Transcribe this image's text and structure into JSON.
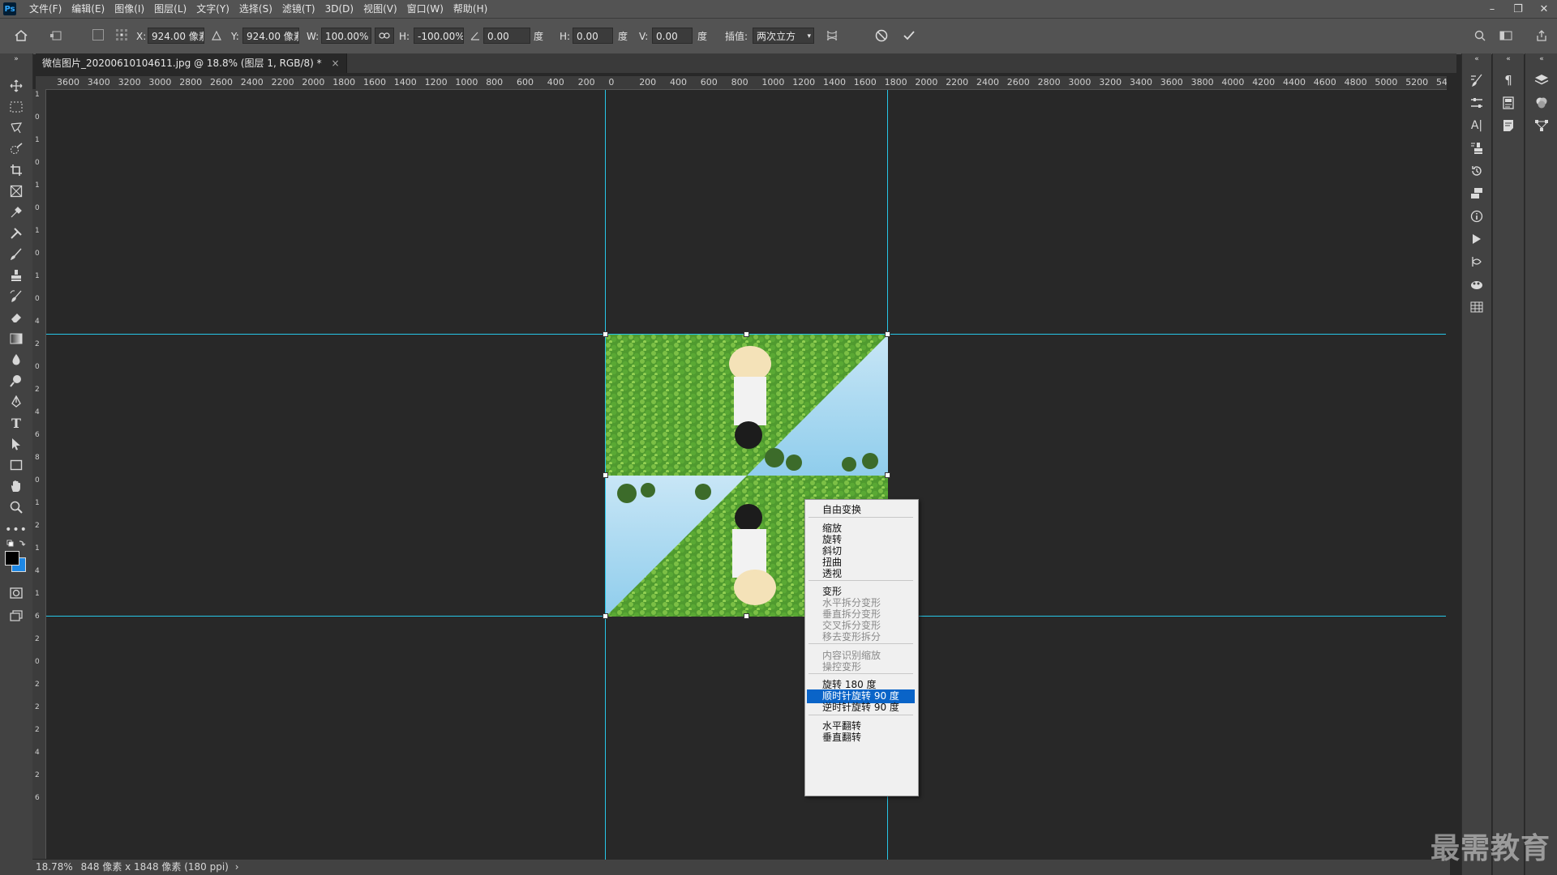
{
  "menubar": {
    "logo": "Ps",
    "items": [
      "文件(F)",
      "编辑(E)",
      "图像(I)",
      "图层(L)",
      "文字(Y)",
      "选择(S)",
      "滤镜(T)",
      "3D(D)",
      "视图(V)",
      "窗口(W)",
      "帮助(H)"
    ]
  },
  "options": {
    "x_label": "X:",
    "x_value": "924.00 像素",
    "y_label": "Y:",
    "y_value": "924.00 像素",
    "w_label": "W:",
    "w_value": "100.00%",
    "h_label": "H:",
    "h_value": "-100.00%",
    "angle_value": "0.00",
    "angle_unit": "度",
    "hskew_label": "H:",
    "hskew_value": "0.00",
    "hskew_unit": "度",
    "vskew_label": "V:",
    "vskew_value": "0.00",
    "vskew_unit": "度",
    "interp_label": "插值:",
    "interp_value": "两次立方"
  },
  "tab": {
    "title": "微信图片_20200610104611.jpg @ 18.8% (图层 1, RGB/8) *",
    "close": "×"
  },
  "ruler": {
    "h_labels": [
      "3600",
      "3400",
      "3200",
      "3000",
      "2800",
      "2600",
      "2400",
      "2200",
      "2000",
      "1800",
      "1600",
      "1400",
      "1200",
      "1000",
      "800",
      "600",
      "400",
      "200",
      "0",
      "200",
      "400",
      "600",
      "800",
      "1000",
      "1200",
      "1400",
      "1600",
      "1800",
      "2000",
      "2200",
      "2400",
      "2600",
      "2800",
      "3000",
      "3200",
      "3400",
      "3600",
      "3800",
      "4000",
      "4200",
      "4400",
      "4600",
      "4800",
      "5000",
      "5200",
      "54"
    ],
    "v_labels": [
      "1",
      "0",
      "1",
      "0",
      "1",
      "0",
      "1",
      "0",
      "1",
      "0",
      "4",
      "2",
      "0",
      "2",
      "4",
      "6",
      "8",
      "0",
      "1",
      "2",
      "1",
      "4",
      "1",
      "6",
      "2",
      "0",
      "2",
      "2",
      "2",
      "4",
      "2",
      "6"
    ]
  },
  "context_menu": {
    "items": [
      {
        "label": "自由变换",
        "disabled": false
      },
      {
        "label": "缩放",
        "disabled": false
      },
      {
        "label": "旋转",
        "disabled": false
      },
      {
        "label": "斜切",
        "disabled": false
      },
      {
        "label": "扭曲",
        "disabled": false
      },
      {
        "label": "透视",
        "disabled": false
      },
      {
        "label": "变形",
        "disabled": false
      },
      {
        "label": "水平拆分变形",
        "disabled": true
      },
      {
        "label": "垂直拆分变形",
        "disabled": true
      },
      {
        "label": "交叉拆分变形",
        "disabled": true
      },
      {
        "label": "移去变形拆分",
        "disabled": true
      },
      {
        "label": "内容识别缩放",
        "disabled": true
      },
      {
        "label": "操控变形",
        "disabled": true
      },
      {
        "label": "旋转 180 度",
        "disabled": false
      },
      {
        "label": "顺时针旋转 90 度",
        "disabled": false,
        "selected": true
      },
      {
        "label": "逆时针旋转 90 度",
        "disabled": false
      },
      {
        "label": "水平翻转",
        "disabled": false
      },
      {
        "label": "垂直翻转",
        "disabled": false
      }
    ]
  },
  "status": {
    "zoom": "18.78%",
    "doc_info": "848 像素 x 1848 像素 (180 ppi)"
  },
  "watermark": "最需教育",
  "colors": {
    "guide": "#27c7e8",
    "menu_highlight": "#0a64c8",
    "foreground": "#000000",
    "background_swatch": "#1e88e5"
  }
}
